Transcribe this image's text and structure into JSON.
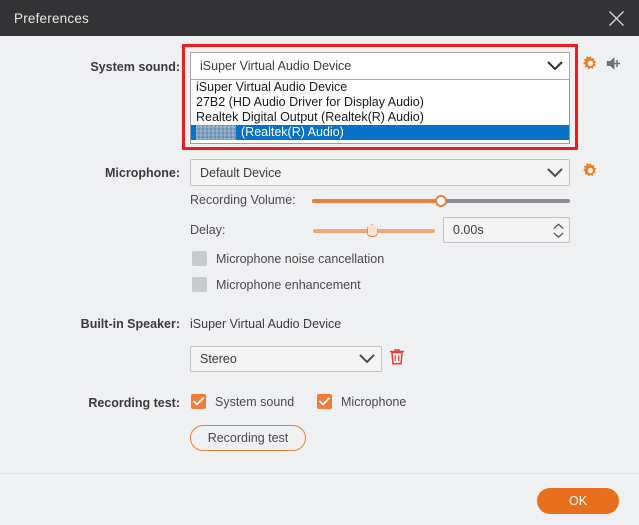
{
  "window": {
    "title": "Preferences",
    "close_icon": "close-icon"
  },
  "system_sound": {
    "label": "System sound:",
    "selected": "iSuper Virtual Audio Device",
    "dropdown_open": true,
    "options": [
      {
        "text": "iSuper Virtual Audio Device",
        "selected": false,
        "obscured": false
      },
      {
        "text": "27B2 (HD Audio Driver for Display Audio)",
        "selected": false,
        "obscured": false
      },
      {
        "text": "Realtek Digital Output (Realtek(R) Audio)",
        "selected": false,
        "obscured": false
      },
      {
        "text": "(Realtek(R) Audio)",
        "selected": true,
        "obscured": true
      }
    ],
    "settings_icon": "gear-icon",
    "volume_icon": "speaker-icon"
  },
  "microphone": {
    "label": "Microphone:",
    "selected": "Default Device",
    "settings_icon": "gear-icon",
    "recording_volume": {
      "label": "Recording Volume:",
      "value": 50,
      "min": 0,
      "max": 100
    },
    "delay": {
      "label": "Delay:",
      "value": 0,
      "display": "0.00s",
      "min": 0,
      "max": 100
    },
    "checkboxes": [
      {
        "label": "Microphone noise cancellation",
        "checked": false
      },
      {
        "label": "Microphone enhancement",
        "checked": false
      }
    ]
  },
  "builtin_speaker": {
    "label": "Built-in Speaker:",
    "device": "iSuper Virtual Audio Device",
    "channel_selected": "Stereo",
    "delete_icon": "trash-icon"
  },
  "recording_test": {
    "label": "Recording test:",
    "checkboxes": [
      {
        "label": "System sound",
        "checked": true
      },
      {
        "label": "Microphone",
        "checked": true
      }
    ],
    "button_label": "Recording test"
  },
  "footer": {
    "ok_label": "OK"
  },
  "colors": {
    "accent_orange": "#ed7d3a",
    "primary_button": "#e8701c",
    "highlight_red": "#ed1b24",
    "selection_blue": "#0a72c6",
    "titlebar": "#333336",
    "background": "#eff0f2",
    "trash_red": "#e8403a"
  }
}
